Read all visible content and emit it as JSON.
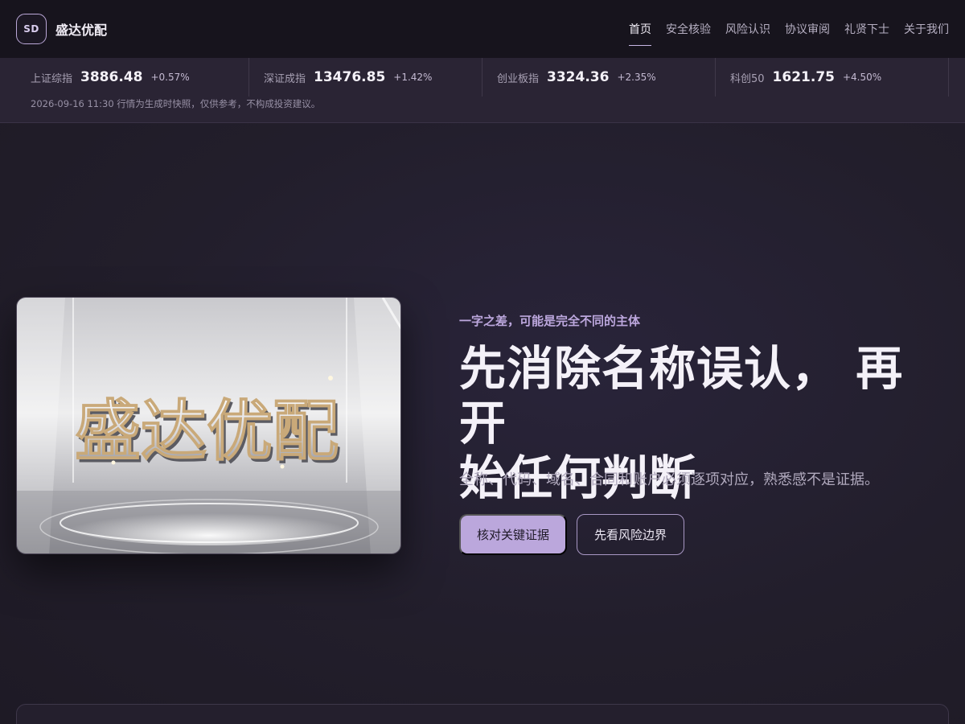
{
  "header": {
    "logo_text": "SD",
    "brand_name": "盛达优配",
    "nav": [
      {
        "label": "首页",
        "active": true
      },
      {
        "label": "安全核验",
        "active": false
      },
      {
        "label": "风险认识",
        "active": false
      },
      {
        "label": "协议审阅",
        "active": false
      },
      {
        "label": "礼贤下士",
        "active": false
      },
      {
        "label": "关于我们",
        "active": false
      }
    ]
  },
  "ticker": {
    "items": [
      {
        "name": "上证综指",
        "value": "3886.48",
        "change": "+0.57%"
      },
      {
        "name": "深证成指",
        "value": "13476.85",
        "change": "+1.42%"
      },
      {
        "name": "创业板指",
        "value": "3324.36",
        "change": "+2.35%"
      },
      {
        "name": "科创50",
        "value": "1621.75",
        "change": "+4.50%"
      }
    ],
    "note": "2026-09-16 11:30 行情为生成时快照，仅供参考，不构成投资建议。"
  },
  "hero": {
    "image_text": "盛达优配",
    "eyebrow": "一字之差，可能是完全不同的主体",
    "headline_line1": "先消除名称误认， 再开",
    "headline_line2": "始任何判断",
    "subline": "全称、代码、域名、合同和账户必须逐项对应，熟悉感不是证据。",
    "primary_button": "核对关键证据",
    "secondary_button": "先看风险边界"
  },
  "colors": {
    "accent": "#bba7dc",
    "background": "#211d29",
    "topbar": "#17141d",
    "ticker_band": "#2a2434"
  }
}
